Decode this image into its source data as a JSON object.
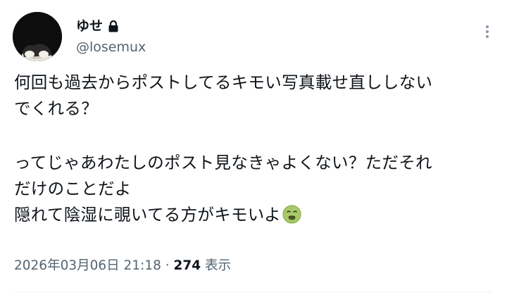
{
  "author": {
    "display_name": "ゆせ",
    "handle": "@losemux",
    "avatar_icon": "avatar-image",
    "protected_icon": "lock-icon"
  },
  "post": {
    "lines": [
      "何回も過去からポストしてるキモい写真載せ直ししない",
      "でくれる？",
      "",
      "ってじゃあわたしのポスト見なきゃよくない？ただそれ",
      "だけのことだよ",
      "隠れて陰湿に覗いてる方がキモいよ"
    ],
    "emoji": "nauseated-face-emoji"
  },
  "meta": {
    "timestamp": "2026年03月06日 21:18",
    "separator": "·",
    "view_count": "274",
    "view_label": "表示"
  },
  "more_icon": "more-vertical-icon",
  "colors": {
    "text": "#0f1419",
    "secondary": "#536471",
    "divider": "#eff3f4"
  }
}
